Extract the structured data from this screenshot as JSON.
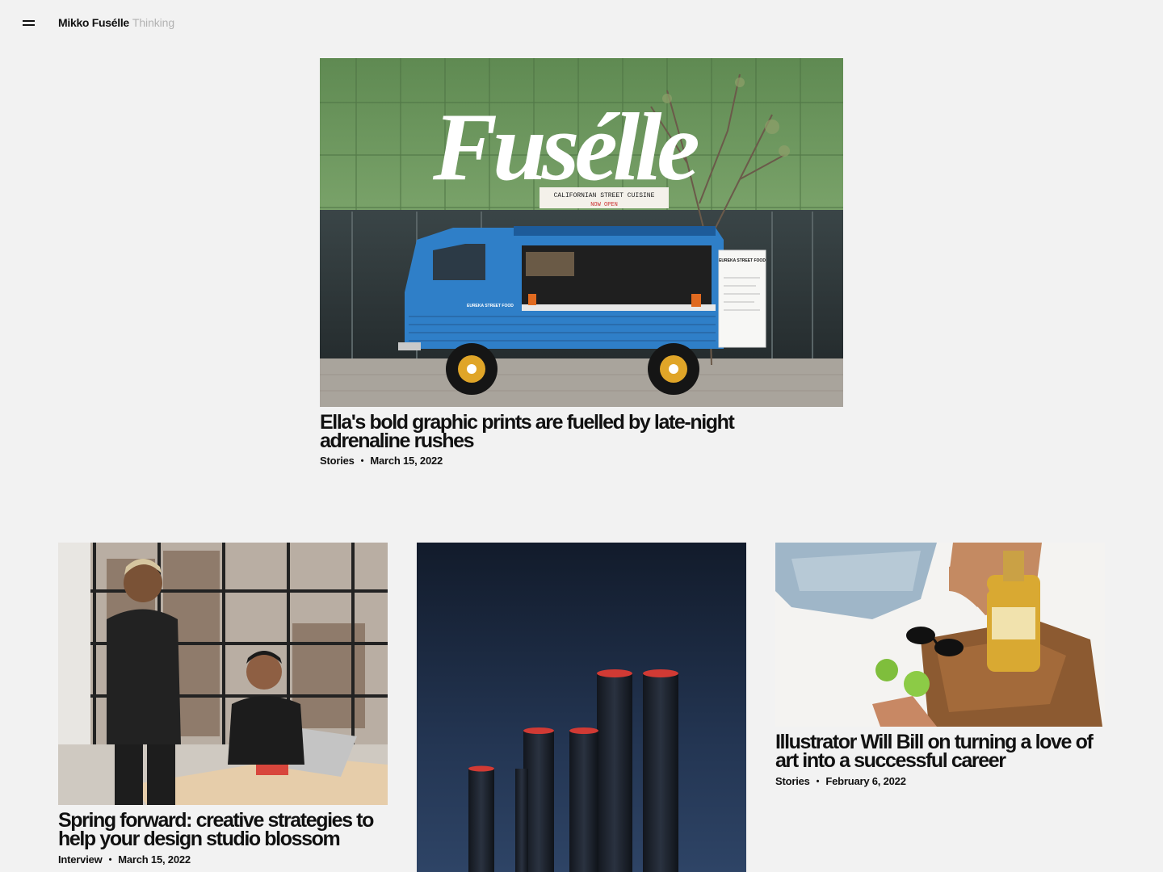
{
  "header": {
    "brand_name": "Mikko Fusélle",
    "section_label": "Thinking",
    "menu_icon": "hamburger-icon"
  },
  "featured": {
    "title": "Ella's bold graphic prints are fuelled by late-night adrenaline rushes",
    "category": "Stories",
    "date": "March 15, 2022",
    "image": {
      "logo_text": "Fusélle",
      "sign_text": "CALIFORNIAN STREET CUISINE",
      "sign_subtext": "NOW OPEN",
      "truck_text": "EUREKA STREET FOOD",
      "menu_board_text": "EUREKA STREET FOOD"
    }
  },
  "articles": [
    {
      "title": "Spring forward: creative strategies to help your design studio blossom",
      "category": "Interview",
      "date": "March 15, 2022"
    },
    {
      "title": "",
      "category": "",
      "date": ""
    },
    {
      "title": "Illustrator Will Bill on turning a love of art into a successful career",
      "category": "Stories",
      "date": "February 6, 2022"
    }
  ],
  "colors": {
    "background": "#f2f2f2",
    "text": "#111111",
    "muted": "#b2b2b2",
    "truck_blue": "#2f7fc8",
    "wall_green": "#6f9a5f"
  }
}
